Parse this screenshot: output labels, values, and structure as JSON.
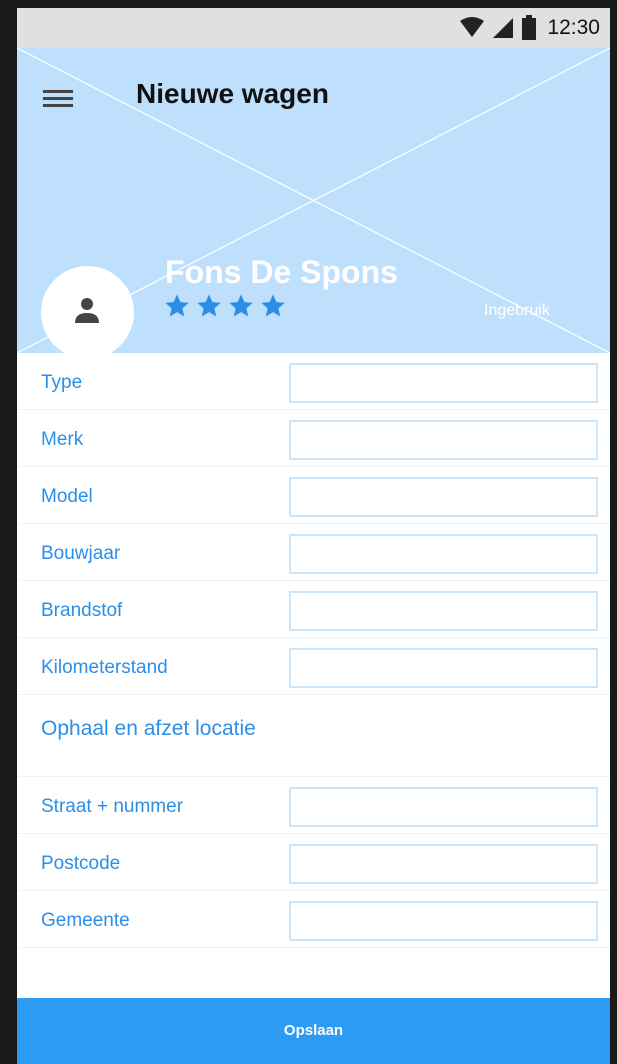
{
  "status_bar": {
    "time": "12:30",
    "icons": [
      "wifi-icon",
      "cell-signal-icon",
      "battery-icon"
    ]
  },
  "header": {
    "title": "Nieuwe wagen",
    "menu_icon": "hamburger-menu-icon",
    "profile": {
      "name": "Fons De Spons",
      "avatar_icon": "person-icon",
      "rating": 4,
      "status": "Ingebruik"
    }
  },
  "form": {
    "fields": [
      {
        "label": "Type",
        "value": ""
      },
      {
        "label": "Merk",
        "value": ""
      },
      {
        "label": "Model",
        "value": ""
      },
      {
        "label": "Bouwjaar",
        "value": ""
      },
      {
        "label": "Brandstof",
        "value": ""
      },
      {
        "label": "Kilometerstand",
        "value": ""
      }
    ],
    "section_title": "Ophaal en afzet locatie",
    "location_fields": [
      {
        "label": "Straat + nummer",
        "value": ""
      },
      {
        "label": "Postcode",
        "value": ""
      },
      {
        "label": "Gemeente",
        "value": ""
      }
    ]
  },
  "actions": {
    "save_label": "Opslaan"
  },
  "colors": {
    "accent": "#2b9bf4",
    "label": "#2b8fe8",
    "header_bg": "#bfe0fd",
    "status_bar_bg": "#e0e0e0"
  }
}
